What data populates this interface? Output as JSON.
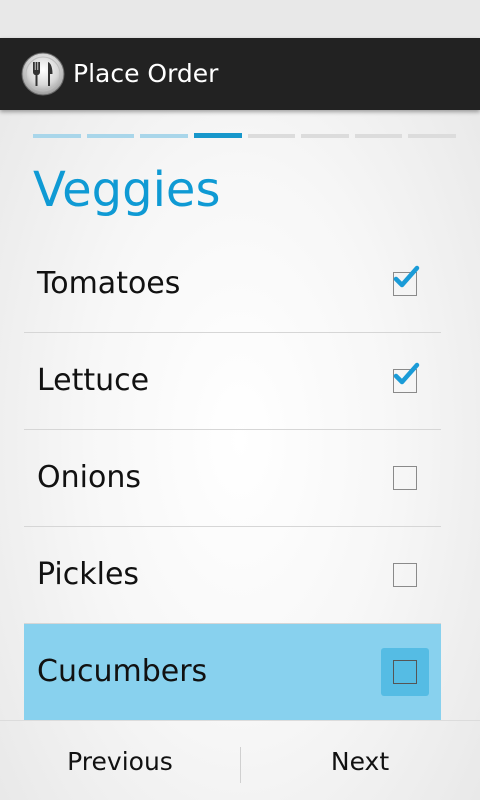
{
  "action_bar": {
    "title": "Place Order",
    "icon": "fork-knife-icon"
  },
  "progress": {
    "total_steps": 8,
    "current_step": 4
  },
  "page": {
    "title": "Veggies"
  },
  "items": [
    {
      "label": "Tomatoes",
      "checked": true,
      "highlighted": false
    },
    {
      "label": "Lettuce",
      "checked": true,
      "highlighted": false
    },
    {
      "label": "Onions",
      "checked": false,
      "highlighted": false
    },
    {
      "label": "Pickles",
      "checked": false,
      "highlighted": false
    },
    {
      "label": "Cucumbers",
      "checked": false,
      "highlighted": true
    }
  ],
  "navigation": {
    "previous_label": "Previous",
    "next_label": "Next"
  },
  "colors": {
    "accent": "#0f9ad4",
    "highlight": "#88d1ee",
    "action_bar": "#222222"
  }
}
